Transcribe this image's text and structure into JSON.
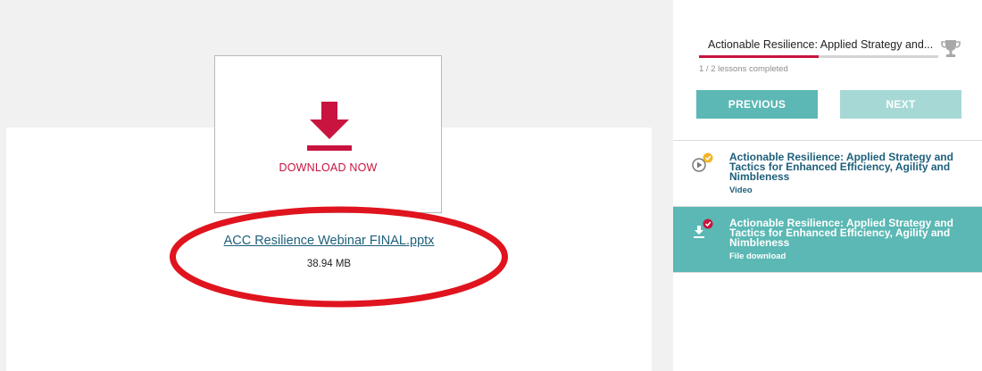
{
  "main": {
    "download_label": "DOWNLOAD NOW",
    "file_name": "ACC Resilience Webinar FINAL.pptx",
    "file_size": "38.94 MB"
  },
  "sidebar": {
    "course_title": "Actionable Resilience: Applied Strategy and...",
    "progress": {
      "completed": 1,
      "total": 2,
      "text": "1 / 2 lessons completed"
    },
    "previous_label": "PREVIOUS",
    "next_label": "NEXT",
    "lessons": [
      {
        "title": "Actionable Resilience: Applied Strategy and Tactics for Enhanced Efficiency, Agility and Nimbleness",
        "type": "Video",
        "icon": "play-icon",
        "status_color": "#f2b526",
        "active": false
      },
      {
        "title": "Actionable Resilience: Applied Strategy and Tactics for Enhanced Efficiency, Agility and Nimbleness",
        "type": "File download",
        "icon": "download-icon",
        "status_color": "#c8143f",
        "active": true
      }
    ]
  },
  "colors": {
    "accent": "#c8143f",
    "teal": "#5bb8b4",
    "teal_disabled": "#a6d9d6",
    "link": "#1d5f7a",
    "highlight_ellipse": "#e0141e"
  }
}
